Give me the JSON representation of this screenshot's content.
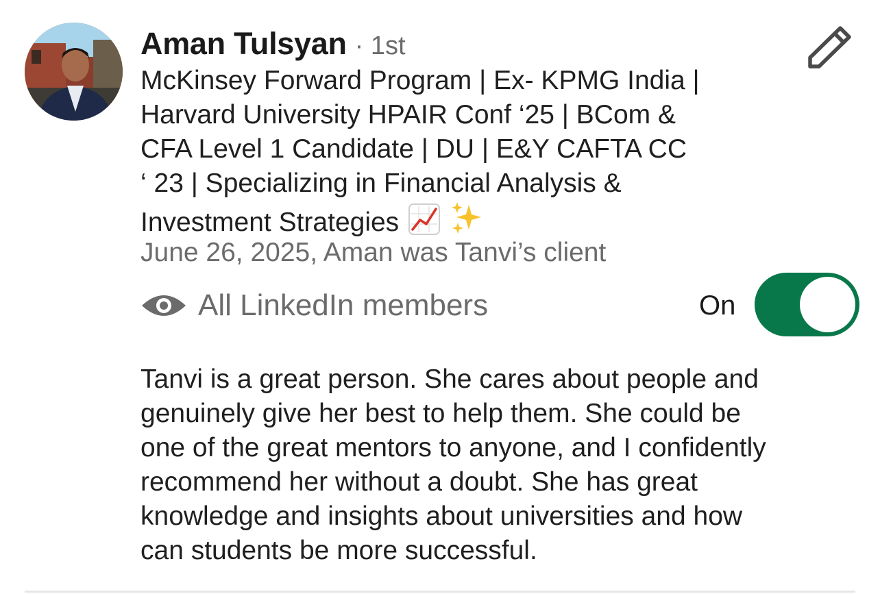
{
  "recommendation": {
    "author_name": "Aman Tulsyan",
    "connection_degree": "· 1st",
    "headline_lines": [
      "McKinsey Forward Program | Ex- KPMG India |",
      "Harvard University HPAIR Conf ‘25 | BCom &",
      "CFA Level 1 Candidate | DU | E&Y CAFTA CC",
      "‘ 23 | Specializing in Financial Analysis &",
      "Investment Strategies"
    ],
    "headline_emojis": [
      "chart-increasing-icon",
      "sparkles-icon"
    ],
    "meta": "June 26, 2025, Aman was Tanvi’s client",
    "visibility_label": "All LinkedIn members",
    "visibility_icon": "eye-icon",
    "toggle_label": "On",
    "toggle_on": true,
    "body_lines": [
      "Tanvi is a great person. She cares about people and",
      "genuinely give her best to help them. She could be",
      "one of the great mentors to anyone, and I confidently",
      "recommend her without a doubt. She has great",
      "knowledge and insights about universities and how",
      "can students be more successful."
    ]
  },
  "colors": {
    "toggle_on": "#08784a",
    "secondary_text": "#6b6b6b",
    "primary_text": "#1f1f1f"
  }
}
